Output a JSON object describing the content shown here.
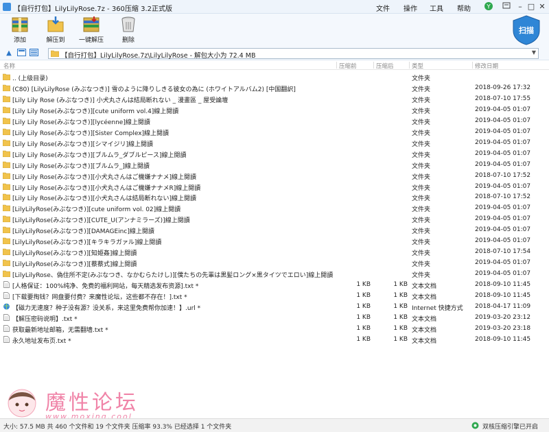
{
  "window": {
    "title": "【自行打包】LilyLilyRose.7z - 360压缩 3.2正式版",
    "menu": [
      "文件",
      "操作",
      "工具",
      "帮助"
    ],
    "accent": "#2c77c9"
  },
  "toolbar": {
    "add_label": "添加",
    "extract_label": "解压到",
    "oneclick_label": "一键解压",
    "delete_label": "删除",
    "scan_label": "扫描"
  },
  "address": {
    "path": "【自行打包】LilyLilyRose.7z\\LilyLilyRose - 解包大小为 72.4 MB"
  },
  "columns": {
    "name": "名称",
    "compressed_before": "压缩前",
    "compressed_after": "压缩后",
    "type": "类型",
    "modified": "修改日期"
  },
  "rows": [
    {
      "icon": "folder-up-icon",
      "name": ".. (上级目录)",
      "size1": "",
      "size2": "",
      "type": "文件夹",
      "date": ""
    },
    {
      "icon": "folder-icon",
      "name": "(C80) [LilyLilyRose (みぶなつき)] 雪のように降りしきる彼女の為に (ホワイトアルバム2) [中国翻訳]",
      "size1": "",
      "size2": "",
      "type": "文件夹",
      "date": "2018-09-26 17:32"
    },
    {
      "icon": "folder-icon",
      "name": "[Lily Lily Rose (みぶなつき)] 小犬丸さんは結局断れない _ 漫畫區 _ 屋受論壇",
      "size1": "",
      "size2": "",
      "type": "文件夹",
      "date": "2018-07-10 17:55"
    },
    {
      "icon": "folder-icon",
      "name": "[Lily Lily Rose(みぶなつき)][cute uniform vol.4]線上閱讀",
      "size1": "",
      "size2": "",
      "type": "文件夹",
      "date": "2019-04-05 01:07"
    },
    {
      "icon": "folder-icon",
      "name": "[Lily Lily Rose(みぶなつき)][lycéenne]線上閱讀",
      "size1": "",
      "size2": "",
      "type": "文件夹",
      "date": "2019-04-05 01:07"
    },
    {
      "icon": "folder-icon",
      "name": "[Lily Lily Rose(みぶなつき)][Sister Complex]線上閱讀",
      "size1": "",
      "size2": "",
      "type": "文件夹",
      "date": "2019-04-05 01:07"
    },
    {
      "icon": "folder-icon",
      "name": "[Lily Lily Rose(みぶなつき)][シマイジリ]線上閱讀",
      "size1": "",
      "size2": "",
      "type": "文件夹",
      "date": "2019-04-05 01:07"
    },
    {
      "icon": "folder-icon",
      "name": "[Lily Lily Rose(みぶなつき)][ブルムラ_ダブルピース]線上閱讀",
      "size1": "",
      "size2": "",
      "type": "文件夹",
      "date": "2019-04-05 01:07"
    },
    {
      "icon": "folder-icon",
      "name": "[Lily Lily Rose(みぶなつき)][ブルムラ_]線上閱讀",
      "size1": "",
      "size2": "",
      "type": "文件夹",
      "date": "2019-04-05 01:07"
    },
    {
      "icon": "folder-icon",
      "name": "[Lily Lily Rose(みぶなつき)][小犬丸さんはご機嫌ナナメ]線上閱讀",
      "size1": "",
      "size2": "",
      "type": "文件夹",
      "date": "2018-07-10 17:52"
    },
    {
      "icon": "folder-icon",
      "name": "[Lily Lily Rose(みぶなつき)][小犬丸さんはご機嫌ナナメR]線上閱讀",
      "size1": "",
      "size2": "",
      "type": "文件夹",
      "date": "2019-04-05 01:07"
    },
    {
      "icon": "folder-icon",
      "name": "[Lily Lily Rose(みぶなつき)][小犬丸さんは結局断れない]線上閱讀",
      "size1": "",
      "size2": "",
      "type": "文件夹",
      "date": "2018-07-10 17:52"
    },
    {
      "icon": "folder-icon",
      "name": "[LilyLilyRose(みぶなつき)][cute uniform vol. 02]線上閱讀",
      "size1": "",
      "size2": "",
      "type": "文件夹",
      "date": "2019-04-05 01:07"
    },
    {
      "icon": "folder-icon",
      "name": "[LilyLilyRose(みぶなつき)][CUTE_U(アンナミラーズ)]線上閱讀",
      "size1": "",
      "size2": "",
      "type": "文件夹",
      "date": "2019-04-05 01:07"
    },
    {
      "icon": "folder-icon",
      "name": "[LilyLilyRose(みぶなつき)][DAMAGEinc]線上閱讀",
      "size1": "",
      "size2": "",
      "type": "文件夹",
      "date": "2019-04-05 01:07"
    },
    {
      "icon": "folder-icon",
      "name": "[LilyLilyRose(みぶなつき)][キラキラガァル]線上閱讀",
      "size1": "",
      "size2": "",
      "type": "文件夹",
      "date": "2019-04-05 01:07"
    },
    {
      "icon": "folder-icon",
      "name": "[LilyLilyRose(みぶなつき)][知姫姦]線上閱讀",
      "size1": "",
      "size2": "",
      "type": "文件夹",
      "date": "2018-07-10 17:54"
    },
    {
      "icon": "folder-icon",
      "name": "[LilyLilyRose(みぶなつき)][蔡蔡式]線上閱讀",
      "size1": "",
      "size2": "",
      "type": "文件夹",
      "date": "2019-04-05 01:07"
    },
    {
      "icon": "folder-icon",
      "name": "[LilyLilyRose、偽住所不定(みぶなつき、なかむらたけし)][僕たちの先輩は黒髪ロング×黒タイツでエロい]線上閱讀",
      "size1": "",
      "size2": "",
      "type": "文件夹",
      "date": "2019-04-05 01:07"
    },
    {
      "icon": "text-file-icon",
      "name": "[人格保证：100%纯净、免费的福利网站，每天精选发布资源].txt *",
      "size1": "1 KB",
      "size2": "1 KB",
      "type": "文本文档",
      "date": "2018-09-10 11:45"
    },
    {
      "icon": "text-file-icon",
      "name": "[下载要掏钱？网盘要付费？来魔性论坛，这些都不存在！].txt *",
      "size1": "1 KB",
      "size2": "1 KB",
      "type": "文本文档",
      "date": "2018-09-10 11:45"
    },
    {
      "icon": "internet-shortcut-icon",
      "name": "【磁力无速度？种子没有源？没关系，来这里免费帮你加速！】.url *",
      "size1": "1 KB",
      "size2": "1 KB",
      "type": "Internet 快捷方式",
      "date": "2018-04-17 11:09"
    },
    {
      "icon": "text-file-icon",
      "name": "【解压密码说明】.txt *",
      "size1": "1 KB",
      "size2": "1 KB",
      "type": "文本文档",
      "date": "2019-03-20 23:12"
    },
    {
      "icon": "text-file-icon",
      "name": "获取最新地址邮箱，无需翻墙.txt *",
      "size1": "1 KB",
      "size2": "1 KB",
      "type": "文本文档",
      "date": "2019-03-20 23:18"
    },
    {
      "icon": "text-file-icon",
      "name": "永久地址发布页.txt *",
      "size1": "1 KB",
      "size2": "1 KB",
      "type": "文本文档",
      "date": "2018-09-10 11:45"
    }
  ],
  "watermark": {
    "title": "魔性论坛",
    "url": "www.moxing.cool"
  },
  "status": {
    "left": "大小: 57.5 MB 共 460 个文件和 19 个文件夹 压缩率 93.3% 已经选择 1 个文件夹",
    "right": "双核压缩引擎已开启"
  }
}
